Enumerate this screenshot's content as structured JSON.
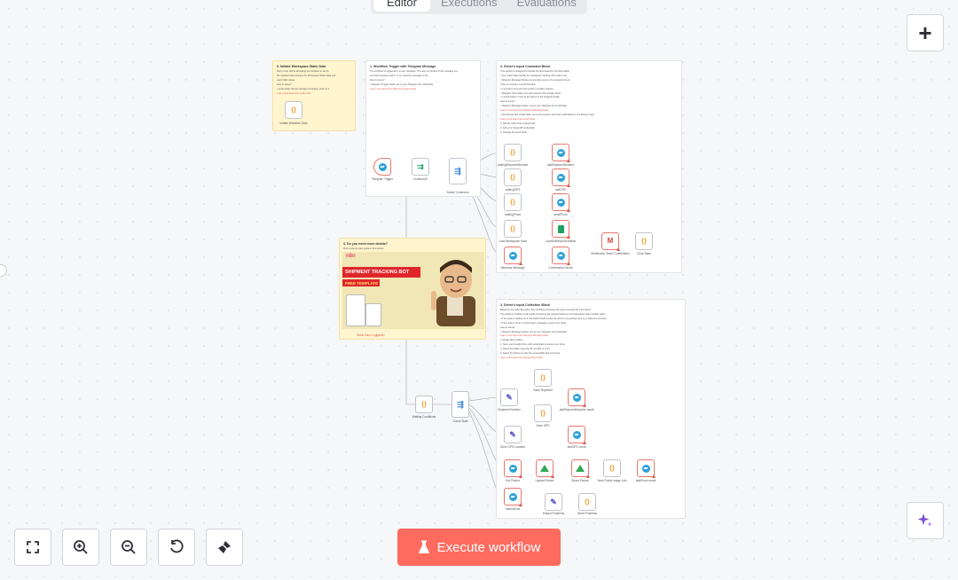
{
  "tabs": [
    {
      "label": "Editor",
      "active": true
    },
    {
      "label": "Executions",
      "active": false
    },
    {
      "label": "Evaluations",
      "active": false
    }
  ],
  "toolbar": {
    "add_icon": "plus-icon",
    "ai_icon": "sparkle-icon",
    "execute_label": "Execute workflow",
    "execute_icon": "flask-icon",
    "zoom_controls": [
      "fit-view-icon",
      "zoom-in-icon",
      "zoom-out-icon",
      "reset-zoom-icon",
      "tidy-up-icon"
    ]
  },
  "colors": {
    "accent": "#ff6b5f",
    "sticky_yellow": "#fff5cf",
    "telegram": "#2ea1da",
    "code": "#f0a030"
  },
  "stickies": {
    "s0": {
      "title": "0. Initiate Workspace Static Data",
      "lines": [
        "Run it once before activating the workflow to set up",
        "the required data structure for Workspace Static Data and",
        "seed initial values.",
        "How to setup?",
        "• Code Node: Set the storage of tracking, push on it",
        "Learn more about the Code node"
      ]
    },
    "s1": {
      "title": "1. Workflow Trigger with Telegram Message",
      "lines": [
        "The workflow is triggered by a user message. The user is checking if the message is a",
        "command (starting with /). If so, route the message to the",
        "How to setup?",
        "• Telegram Trigger Node: set up your Telegram bot credentials",
        "Learn more about the Telegram Trigger Node"
      ]
    },
    "s2": {
      "title": "2. Driver's Input Command Block",
      "lines": [
        "This section is designed to handle the flow based on the information:",
        "• The router helps handle the workspace tracking with code to set",
        "• Telegram Message Nodes are sending users to the expected route",
        "If the command is /confirm/location",
        "• A prompt is sent with the Confirm Location request",
        "• Telegram Information sent and stored in the Google Sheet",
        "• A confirmation is sent to the driver by the Telegram Node",
        "How to setup?",
        "• Telegram Message Nodes: set up your Telegram bot credentials",
        "Learn more about the Telegram Message Node",
        "• Send Email with Gmail Node: set up the email to send the confirmation to the delivery team",
        "Learn more about the Gmail Node",
        "1. Add the path of the recipient file",
        "2. Add your Gmail API credentials",
        "3. Change the Send Node"
      ]
    },
    "s3": {
      "title": "3. Do you need more details?",
      "lines": [
        "Find a step-by-step guide in this tutorial"
      ]
    },
    "s4": {
      "title": "3. Driver's Input Collection Block",
      "lines": [
        "Based on the state flag value, this workflow processes the input expected from the driver:",
        "The tracking condition node reads in listening the request based on the workspace static variable value:",
        "• If the state is waiting for a: the Switch Node routes the driver to a pending input (e.g. shipment number)",
        "• If the state is done: a confirmation message is sent to the driver",
        "How to setup?",
        "• Telegram Message Nodes: set up your Telegram bot credentials",
        "Learn more about the Telegram Message Node",
        "• Google Drive Nodes:",
        "1. Save your Google Drive with credentials to access your drive",
        "2. Select the folder using the ID, an URL or a list",
        "3. Select the Share in order the accessibility link to Anyone",
        "Learn more about the Google Drive Node"
      ]
    }
  },
  "promo": {
    "brand": "n8n",
    "headline": "SHIPMENT TRACKING BOT",
    "subheadline": "FREE TEMPLATE",
    "author": "Samir Saci, Logigreen"
  },
  "nodes": {
    "init": "Initiate Workflow Data",
    "trigger": "Telegram Trigger",
    "command": "Command?",
    "switch_cmd": "Switch Command",
    "waiting_shipment": "waitingShipmentNumber",
    "add_shipment": "addShipmentNumber",
    "waiting_gps": "waitingGPS",
    "add_gps": "addGPS",
    "waiting_photo": "waitingPhoto",
    "send_photo": "sendPhoto",
    "load_data": "Load Workspace Data",
    "load_delivery": "LoadDeliveryInformation",
    "welcome": "Welcome Message",
    "confirmation": "Confirmation Driver",
    "distribution": "Distribution Team Confirmation",
    "clear_state": "Clear State",
    "waiting_conditions": "Waiting Conditions",
    "check_state": "Check State",
    "shipment_number": "Shipment Number",
    "save_shipment": "Save Shipment",
    "add_shipment_result": "addShipmentNumber result",
    "store_gps": "Store GPS Location",
    "save_gps": "Save GPS",
    "add_gps_result": "addGPS result",
    "get_picture": "Get Picture",
    "upload_picture": "Upload Picture",
    "share_picture": "Share Picture",
    "save_public": "Save Public Image Link",
    "add_photo_result": "addPhoto result",
    "instructions": "Instructions",
    "extract_problems": "Extract Problems",
    "store_problems": "Store Problems"
  }
}
